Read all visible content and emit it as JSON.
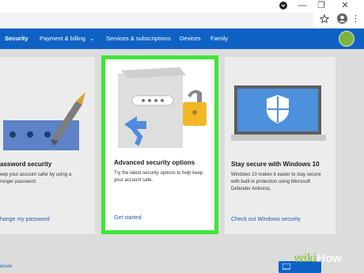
{
  "browser": {
    "minimize": "—",
    "restore": "❐",
    "close": "✕",
    "star_icon": "star-icon",
    "more": "⋮"
  },
  "nav": {
    "items": [
      "Security",
      "Payment & billing",
      "Services & subscriptions",
      "Devices",
      "Family"
    ],
    "dropdown_glyph": "⌄",
    "accent": "#0f62c4"
  },
  "cards": [
    {
      "title": "assword security",
      "description": "eep your account safer by using a\nronger password.",
      "link": "hange my password"
    },
    {
      "title": "Advanced security options",
      "description": "Try the latest security options to help keep\nyour account safe.",
      "link": "Get started"
    },
    {
      "title": "Stay secure with Windows 10",
      "description": "Windows 10 makes it easier to stay secure\nwith built-in protection using Microsoft\nDefender Antivirus.",
      "link": "Check out Windows security"
    }
  ],
  "footer": {
    "left_text": "ecure"
  },
  "highlight_color": "#3ee637",
  "watermark": {
    "w": "wiki",
    "rest": "How"
  }
}
